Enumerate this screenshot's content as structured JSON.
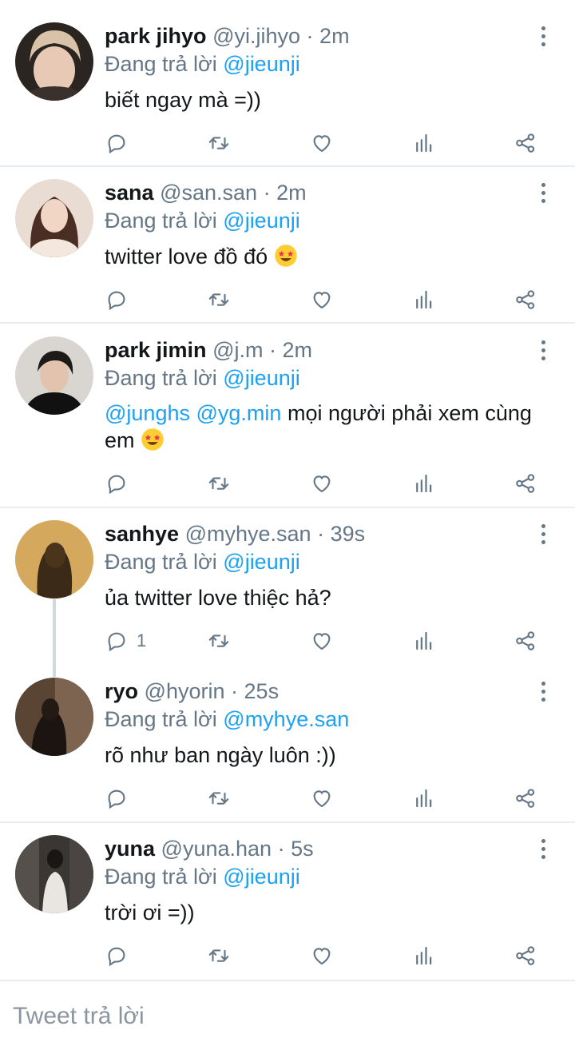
{
  "replying_prefix": "Đang trả lời",
  "compose": {
    "placeholder": "Tweet trả lời"
  },
  "colors": {
    "accent": "#1da1f2",
    "muted": "#657786",
    "divider": "#e6ecf0"
  },
  "tweets": [
    {
      "name": "park jihyo",
      "handle": "@yi.jihyo",
      "dot": "·",
      "time": "2m",
      "reply_to": "@jieunji",
      "text": "biết ngay mà =))",
      "reply_count": ""
    },
    {
      "name": "sana",
      "handle": "@san.san",
      "dot": "·",
      "time": "2m",
      "reply_to": "@jieunji",
      "text": "twitter love đồ đó",
      "reply_count": ""
    },
    {
      "name": "park jimin",
      "handle": "@j.m",
      "dot": "·",
      "time": "2m",
      "reply_to": "@jieunji",
      "mentions": [
        "@junghs",
        "@yg.min"
      ],
      "text": "mọi người phải xem cùng",
      "text_line2": "em",
      "reply_count": ""
    },
    {
      "name": "sanhye",
      "handle": "@myhye.san",
      "dot": "·",
      "time": "39s",
      "reply_to": "@jieunji",
      "text": "ủa twitter love thiệc hả?",
      "reply_count": "1"
    },
    {
      "name": "ryo",
      "handle": "@hyorin",
      "dot": "·",
      "time": "25s",
      "reply_to": "@myhye.san",
      "text": "rõ như ban ngày luôn :))",
      "reply_count": ""
    },
    {
      "name": "yuna",
      "handle": "@yuna.han",
      "dot": "·",
      "time": "5s",
      "reply_to": "@jieunji",
      "text": "trời ơi =))",
      "reply_count": ""
    }
  ]
}
